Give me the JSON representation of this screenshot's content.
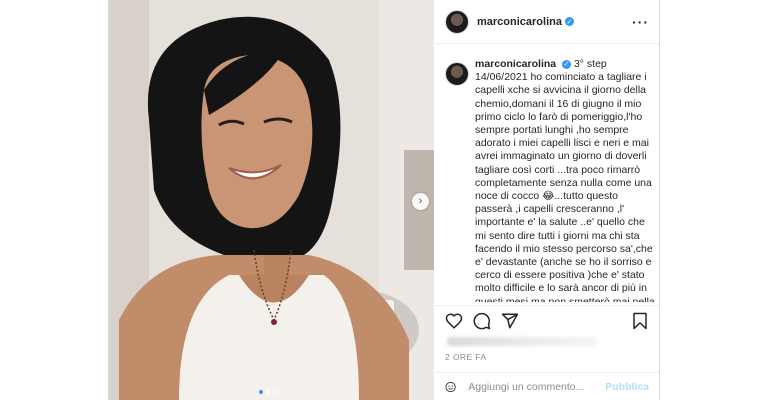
{
  "post": {
    "username": "marconicarolina",
    "verified": true,
    "more_icon": "more-horizontal-icon",
    "caption": {
      "username": "marconicarolina",
      "text": "3° step\n14/06/2021 ho cominciato a tagliare i capelli xche si avvicina il giorno della chemio,domani il 16 di giugno il mio primo ciclo lo farò di pomeriggio,l'ho sempre portati lunghi ,ho sempre adorato i miei capelli lisci e neri e mai avrei immaginato un giorno di doverli tagliare così corti ...tra poco rimarrò completamente senza nulla come una noce di cocco 😂...tutto questo passerà ,i capelli cresceranno ,l' importante e' la salute ..e' quello che mi sento dire tutti i giorni ma chi sta facendo il mio stesso percorso sa',che e' devastante (anche se ho il sorriso e cerco di essere positiva )che e' stato molto difficile e lo sarà ancor di più in questi mesi ma non smetterò mai nella mia vita di essere"
    },
    "time": "2 ORE FA",
    "comment": {
      "placeholder": "Aggiungi un commento...",
      "publish_label": "Pubblica"
    },
    "icons": [
      "heart-icon",
      "comment-icon",
      "share-icon",
      "bookmark-icon",
      "emoji-icon",
      "chevron-right-icon"
    ],
    "colors": {
      "accent": "#3897f0",
      "publish_disabled": "#b2dffc",
      "secondary_text": "#8e8e8e"
    }
  }
}
